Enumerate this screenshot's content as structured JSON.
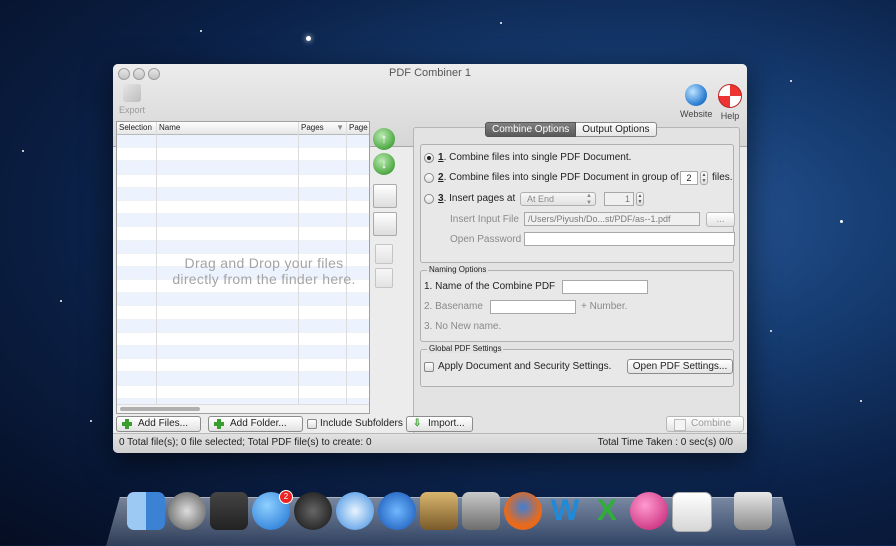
{
  "window": {
    "title": "PDF Combiner 1",
    "toolbar": {
      "export": "Export",
      "website": "Website",
      "help": "Help"
    }
  },
  "table": {
    "columns": [
      "Selection",
      "Name",
      "Pages",
      "Page"
    ],
    "drop_message_line1": "Drag  and  Drop  your  files",
    "drop_message_line2": "directly from the finder here."
  },
  "tabs": {
    "active": "Combine Options",
    "inactive": "Output Options"
  },
  "combine": {
    "option1_num": "1",
    "option1": ". Combine files into single PDF Document.",
    "option2_num": "2",
    "option2": ". Combine files into single PDF Document in group of",
    "group_value": "2",
    "files_label": "files.",
    "option3_num": "3",
    "option3": ". Insert pages at",
    "insert_position": "At End",
    "insert_page_value": "1",
    "insert_input_file_label": "Insert Input File",
    "insert_input_file_value": "/Users/Piyush/Do...st/PDF/as--1.pdf",
    "browse_label": "...",
    "open_password_label": "Open Password"
  },
  "naming": {
    "legend": "Naming Options",
    "option1": "1. Name of the Combine PDF",
    "option2": "2. Basename",
    "number_suffix": "+ Number.",
    "option3": "3. No New name."
  },
  "global": {
    "legend": "Global PDF Settings",
    "apply_label": "Apply Document and Security Settings.",
    "open_settings": "Open PDF Settings..."
  },
  "bottom": {
    "add_files": "Add Files...",
    "add_folder": "Add Folder...",
    "include_subfolders": "Include Subfolders",
    "import": "Import...",
    "combine": "Combine"
  },
  "status": {
    "left": "0 Total file(s); 0 file selected; Total PDF file(s) to create: 0",
    "right": "Total Time Taken : 0 sec(s) 0/0"
  },
  "dock": {
    "badge_app_store": "2",
    "icons": [
      "finder-icon",
      "launchpad-icon",
      "photo-booth-icon",
      "app-store-icon",
      "dashboard-icon",
      "safari-icon",
      "itunes-icon",
      "iphoto-icon",
      "system-preferences-icon",
      "firefox-icon",
      "word-icon",
      "excel-icon",
      "bomb-app-icon",
      "pdf-combiner-icon",
      "trash-icon"
    ]
  }
}
